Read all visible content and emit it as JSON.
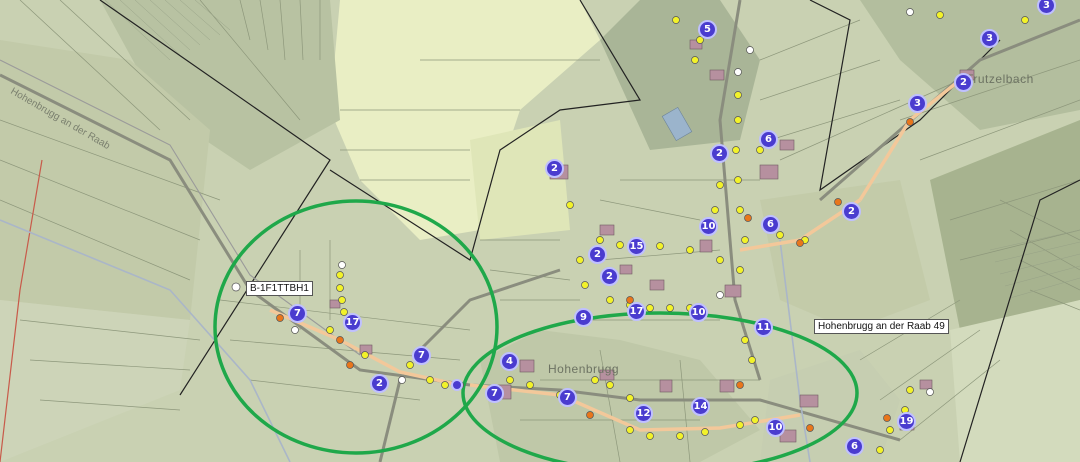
{
  "labels": {
    "node_label": "B-1F1TTBH1",
    "address_label": "Hohenbrugg an der Raab 49",
    "village_name": "Hohenbrugg",
    "hamlet_name": "Trutzelbach",
    "road_name": "Hohenbrugg an der Raab"
  },
  "clusters": [
    {
      "count": "3"
    },
    {
      "count": "5"
    },
    {
      "count": "3"
    },
    {
      "count": "2"
    },
    {
      "count": "3"
    },
    {
      "count": "6"
    },
    {
      "count": "2"
    },
    {
      "count": "2"
    },
    {
      "count": "2"
    },
    {
      "count": "10"
    },
    {
      "count": "6"
    },
    {
      "count": "2"
    },
    {
      "count": "15"
    },
    {
      "count": "2"
    },
    {
      "count": "17"
    },
    {
      "count": "10"
    },
    {
      "count": "9"
    },
    {
      "count": "11"
    },
    {
      "count": "7"
    },
    {
      "count": "17"
    },
    {
      "count": "7"
    },
    {
      "count": "2"
    },
    {
      "count": "4"
    },
    {
      "count": "7"
    },
    {
      "count": "7"
    },
    {
      "count": "12"
    },
    {
      "count": "14"
    },
    {
      "count": "10"
    },
    {
      "count": "6"
    },
    {
      "count": "19"
    }
  ],
  "colors": {
    "cluster": "#4a3ccf",
    "planned_node": "#f2f22a",
    "existing_node": "#e8761c",
    "free_node": "#ffffff",
    "highlight_ring": "#1fa84a",
    "trench": "#f3c89a"
  }
}
